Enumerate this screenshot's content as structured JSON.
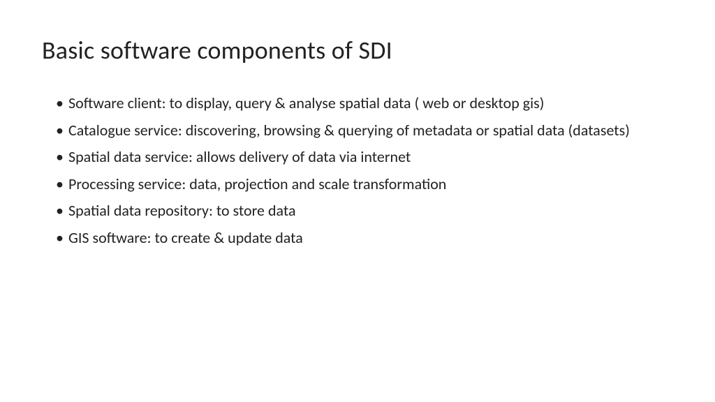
{
  "slide": {
    "title": "Basic software components of SDI",
    "bullets": [
      "Software client: to display, query & analyse spatial data ( web or desktop gis)",
      "Catalogue service: discovering, browsing & querying of metadata or spatial data (datasets)",
      "Spatial data service: allows delivery of data via internet",
      "Processing service: data, projection and scale transformation",
      "Spatial data repository: to store data",
      "GIS software: to create & update data"
    ]
  }
}
